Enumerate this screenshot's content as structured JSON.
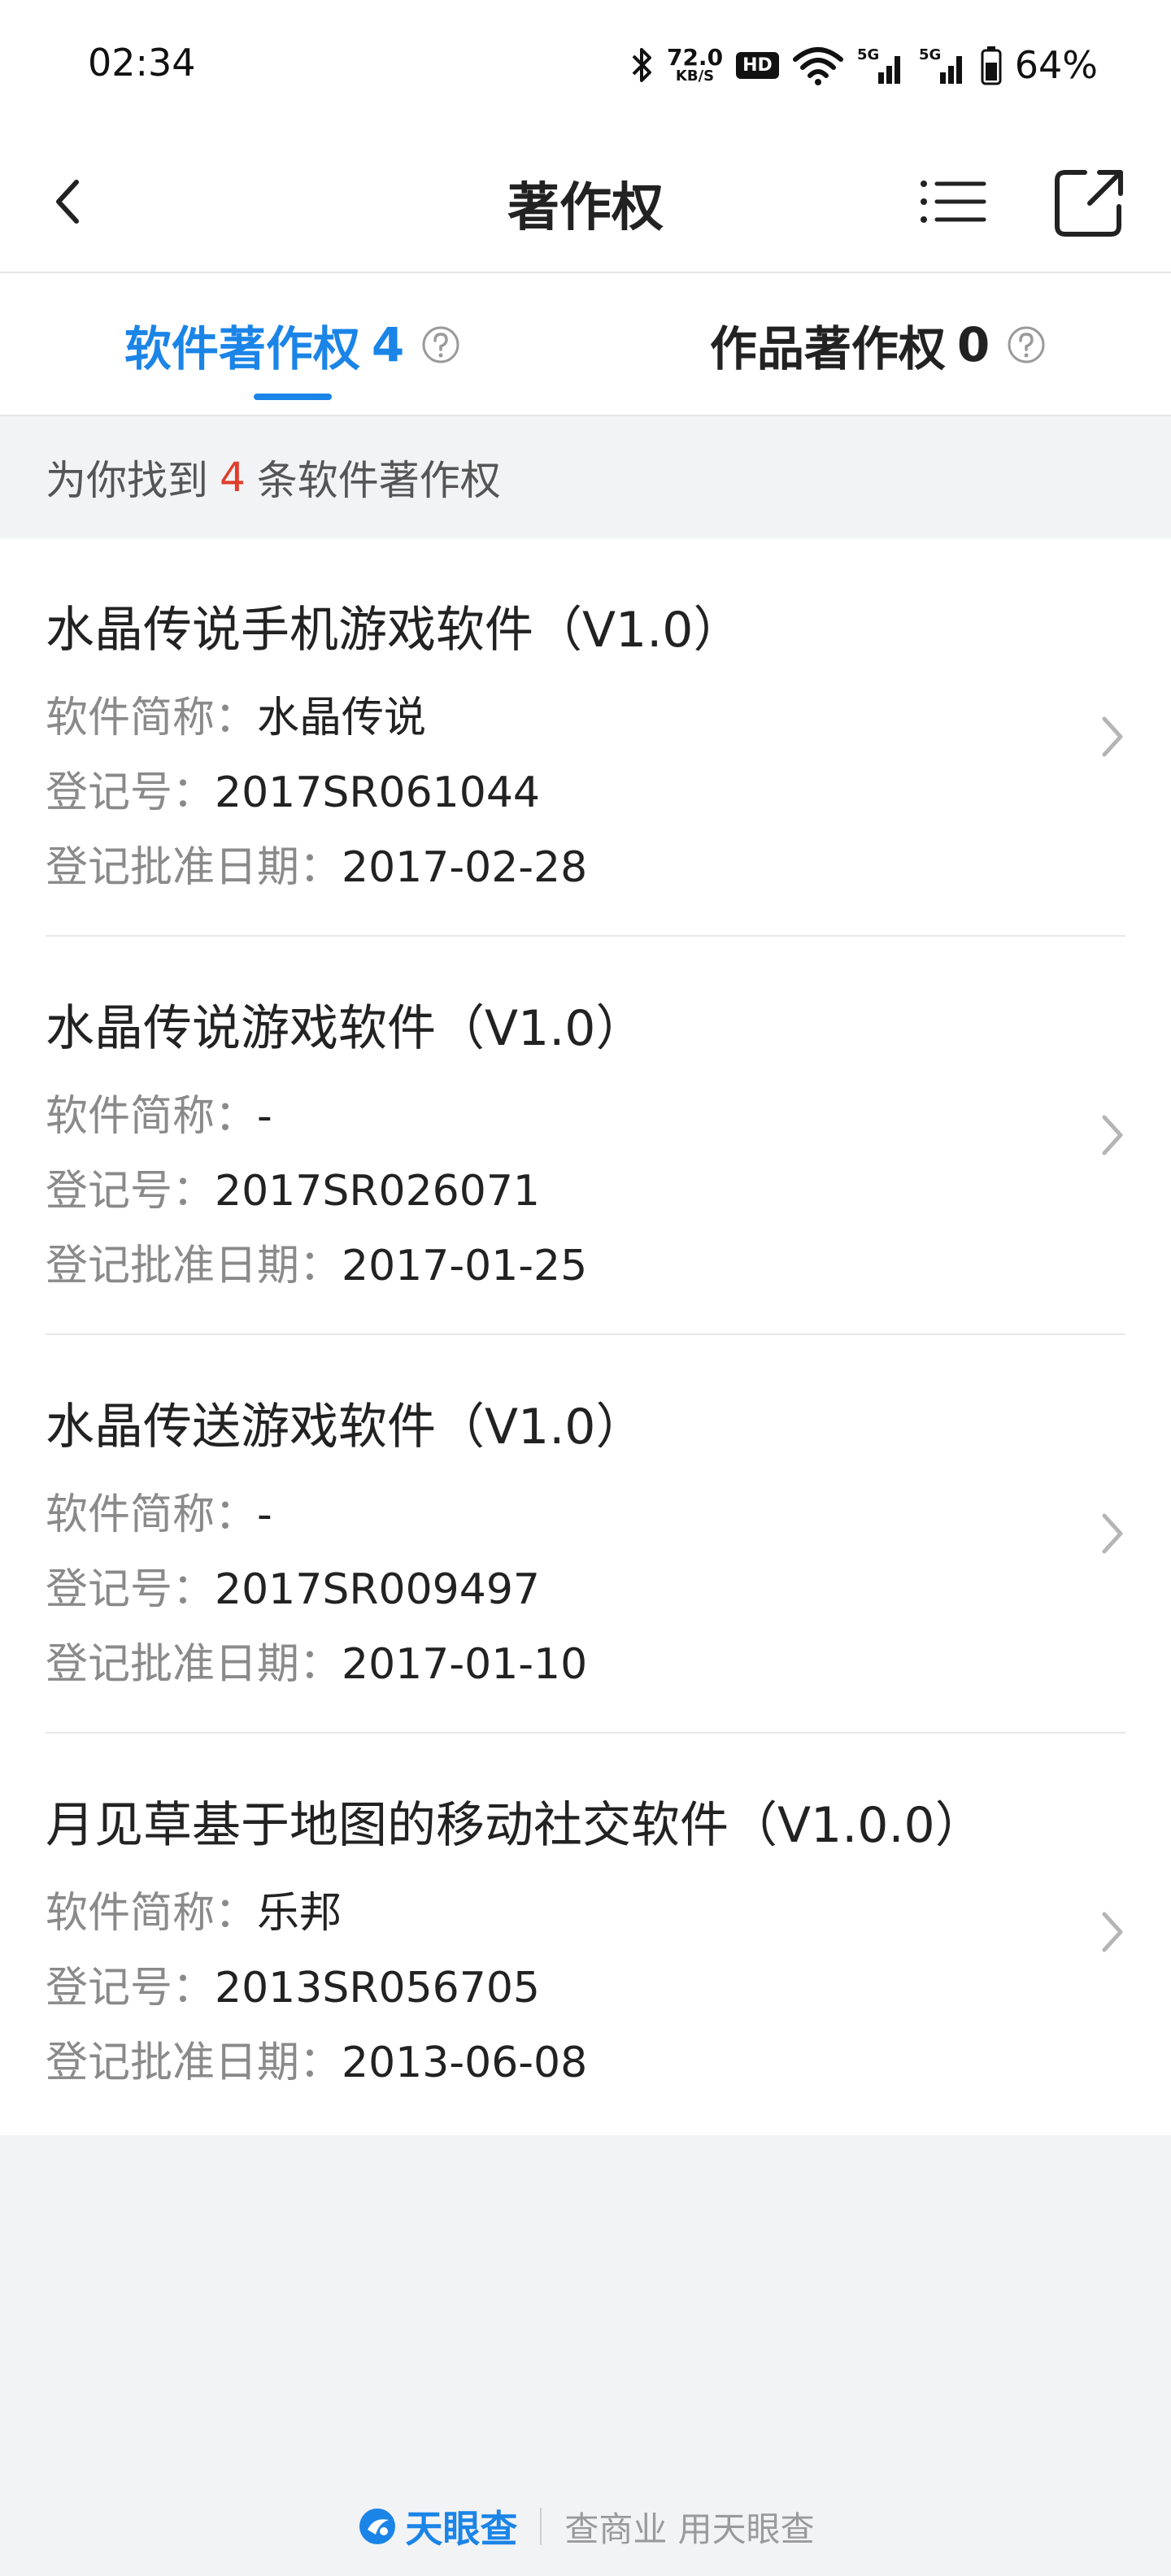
{
  "status_bar": {
    "time": "02:34",
    "net_speed_value": "72.0",
    "net_speed_unit": "KB/S",
    "hd_badge": "HD",
    "battery": "64%"
  },
  "nav": {
    "title": "著作权"
  },
  "tabs": [
    {
      "label": "软件著作权",
      "count": "4",
      "active": true
    },
    {
      "label": "作品著作权",
      "count": "0",
      "active": false
    }
  ],
  "summary": {
    "prefix": "为你找到",
    "count": "4",
    "suffix": "条软件著作权"
  },
  "field_labels": {
    "short_name": "软件简称：",
    "reg_no": "登记号：",
    "approval_date": "登记批准日期："
  },
  "items": [
    {
      "title": "水晶传说手机游戏软件（V1.0）",
      "short_name": "水晶传说",
      "reg_no": "2017SR061044",
      "approval_date": "2017-02-28"
    },
    {
      "title": "水晶传说游戏软件（V1.0）",
      "short_name": "-",
      "reg_no": "2017SR026071",
      "approval_date": "2017-01-25"
    },
    {
      "title": "水晶传送游戏软件（V1.0）",
      "short_name": "-",
      "reg_no": "2017SR009497",
      "approval_date": "2017-01-10"
    },
    {
      "title": "月见草基于地图的移动社交软件（V1.0.0）",
      "short_name": "乐邦",
      "reg_no": "2013SR056705",
      "approval_date": "2013-06-08"
    }
  ],
  "footer": {
    "brand": "天眼查",
    "slogan": "查商业 用天眼查"
  },
  "colors": {
    "accent": "#1b84e7",
    "highlight": "#e03e2d",
    "background": "#f2f3f5"
  }
}
